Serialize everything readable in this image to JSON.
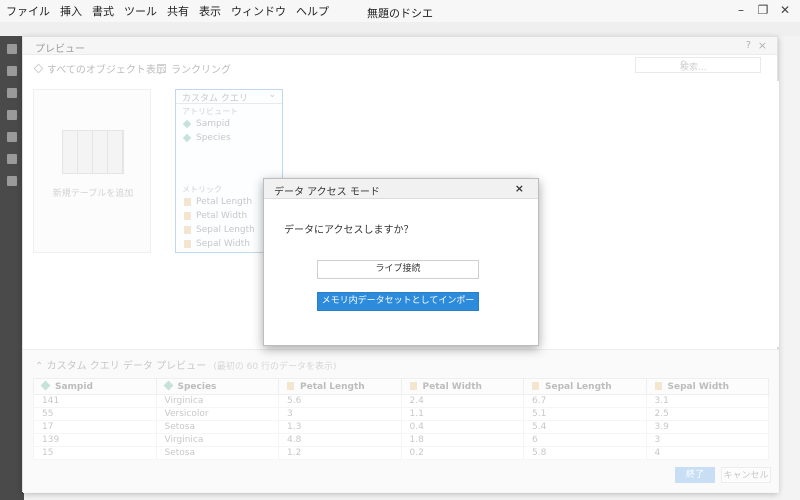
{
  "app": {
    "title": "無題のドシエ",
    "menu": [
      "ファイル",
      "挿入",
      "書式",
      "ツール",
      "共有",
      "表示",
      "ウィンドウ",
      "ヘルプ"
    ]
  },
  "preview": {
    "title": "プレビュー",
    "help": "?",
    "close": "×",
    "tools": {
      "show_all": "すべてのオブジェクト表示",
      "ranking": "ランクリング"
    },
    "search_placeholder": "検索...",
    "new_table_label": "新規テーブルを追加",
    "query_card": {
      "title": "カスタム クエリ",
      "attributes_label": "アトリビュート",
      "attributes": [
        "Sampid",
        "Species"
      ],
      "metrics_label": "メトリック",
      "metrics": [
        "Petal Length",
        "Petal Width",
        "Sepal Length",
        "Sepal Width"
      ]
    },
    "data_preview": {
      "title": "カスタム クエリ データ プレビュー",
      "subtitle": "(最初の 60 行のデータを表示)",
      "columns": [
        "Sampid",
        "Species",
        "Petal Length",
        "Petal Width",
        "Sepal Length",
        "Sepal Width"
      ],
      "rows": [
        [
          "141",
          "Virginica",
          "5.6",
          "2.4",
          "6.7",
          "3.1"
        ],
        [
          "55",
          "Versicolor",
          "3",
          "1.1",
          "5.1",
          "2.5"
        ],
        [
          "17",
          "Setosa",
          "1.3",
          "0.4",
          "5.4",
          "3.9"
        ],
        [
          "139",
          "Virginica",
          "4.8",
          "1.8",
          "6",
          "3"
        ],
        [
          "15",
          "Setosa",
          "1.2",
          "0.2",
          "5.8",
          "4"
        ]
      ]
    },
    "buttons": {
      "done": "終了",
      "cancel": "キャンセル"
    }
  },
  "modal": {
    "title": "データ アクセス モード",
    "close": "×",
    "question": "データにアクセスしますか？",
    "live_button": "ライブ接続",
    "import_button": "メモリ内データセットとしてインポート"
  }
}
